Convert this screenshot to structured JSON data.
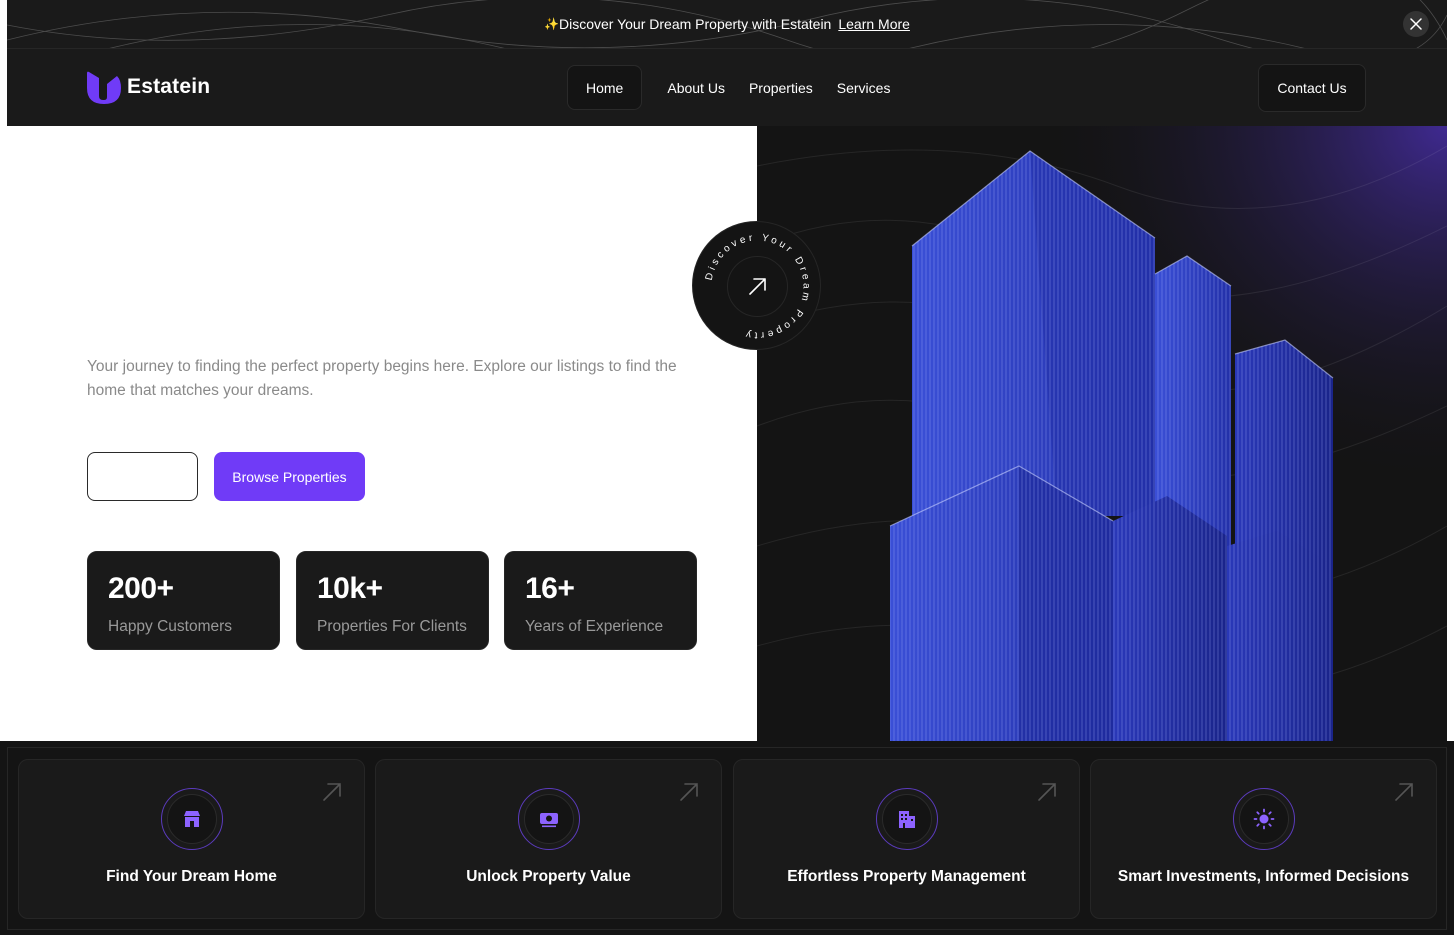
{
  "banner": {
    "sparkle_icon": "sparkle-icon",
    "text": "Discover Your Dream Property with Estatein",
    "link": "Learn More",
    "close_icon": "close-icon"
  },
  "header": {
    "logo_text": "Estatein",
    "nav": [
      "Home",
      "About Us",
      "Properties",
      "Services"
    ],
    "active_nav": "Home",
    "contact_label": "Contact Us"
  },
  "hero": {
    "title": "",
    "description": "Your journey to finding the perfect property begins here. Explore our listings to find the home that matches your dreams.",
    "learn_more_label": "",
    "browse_label": "Browse Properties",
    "badge_text": "Discover Your Dream Property",
    "stats": [
      {
        "value": "200+",
        "label": "Happy Customers"
      },
      {
        "value": "10k+",
        "label": "Properties For Clients"
      },
      {
        "value": "16+",
        "label": "Years of Experience"
      }
    ]
  },
  "features": [
    {
      "title": "Find Your Dream Home",
      "icon": "home-icon"
    },
    {
      "title": "Unlock Property Value",
      "icon": "money-icon"
    },
    {
      "title": "Effortless Property Management",
      "icon": "building-icon"
    },
    {
      "title": "Smart Investments, Informed Decisions",
      "icon": "sun-icon"
    }
  ],
  "colors": {
    "accent": "#703bf7",
    "dark": "#1a1a1a",
    "darker": "#141414",
    "building": "#2f3fbf"
  }
}
